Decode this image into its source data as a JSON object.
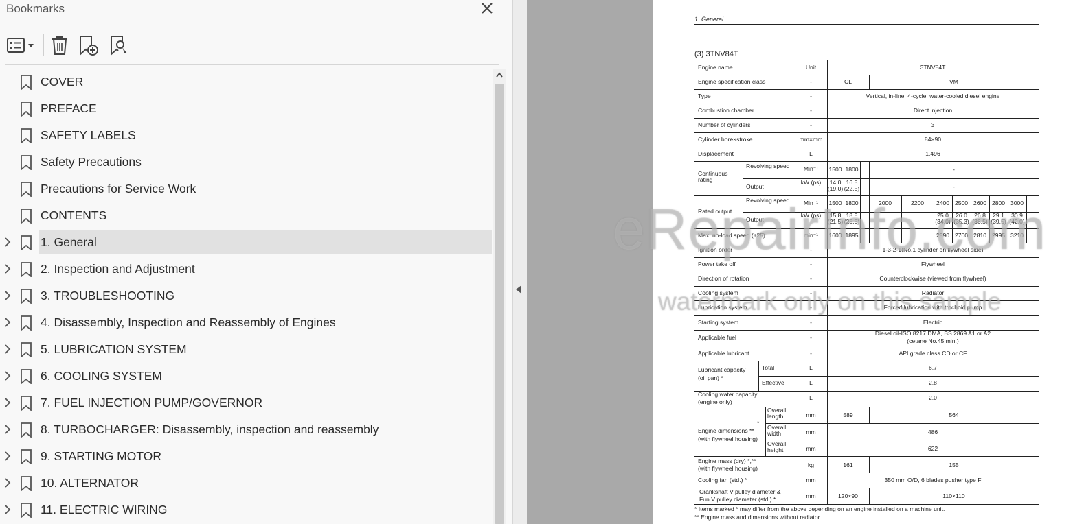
{
  "bookmarks_panel": {
    "title": "Bookmarks",
    "toolbar": {
      "options_icon": "list-options-icon",
      "delete_icon": "trash-icon",
      "new_bookmark_icon": "bookmark-add-icon",
      "find_bookmark_icon": "bookmark-find-icon"
    },
    "items": [
      {
        "label": "COVER",
        "expandable": false,
        "selected": false
      },
      {
        "label": "PREFACE",
        "expandable": false,
        "selected": false
      },
      {
        "label": "SAFETY LABELS",
        "expandable": false,
        "selected": false
      },
      {
        "label": "Safety Precautions",
        "expandable": false,
        "selected": false
      },
      {
        "label": "Precautions for Service Work",
        "expandable": false,
        "selected": false
      },
      {
        "label": "CONTENTS",
        "expandable": false,
        "selected": false
      },
      {
        "label": "1. General",
        "expandable": true,
        "selected": true
      },
      {
        "label": "2. Inspection and Adjustment",
        "expandable": true,
        "selected": false
      },
      {
        "label": "3. TROUBLESHOOTING",
        "expandable": true,
        "selected": false
      },
      {
        "label": "4. Disassembly, Inspection and Reassembly of Engines",
        "expandable": true,
        "selected": false
      },
      {
        "label": "5. LUBRICATION SYSTEM",
        "expandable": true,
        "selected": false
      },
      {
        "label": "6. COOLING SYSTEM",
        "expandable": true,
        "selected": false
      },
      {
        "label": "7. FUEL INJECTION PUMP/GOVERNOR",
        "expandable": true,
        "selected": false
      },
      {
        "label": "8. TURBOCHARGER: Disassembly, inspection and reassembly",
        "expandable": true,
        "selected": false
      },
      {
        "label": "9. STARTING MOTOR",
        "expandable": true,
        "selected": false
      },
      {
        "label": "10. ALTERNATOR",
        "expandable": true,
        "selected": false
      },
      {
        "label": "11. ELECTRIC WIRING",
        "expandable": true,
        "selected": false
      }
    ]
  },
  "document": {
    "header": "1. General",
    "section_title": "(3) 3TNV84T",
    "table": {
      "engine_name": {
        "label": "Engine name",
        "unit": "Unit",
        "value": "3TNV84T"
      },
      "spec_class": {
        "label": "Engine specification class",
        "unit": "-",
        "cl": "CL",
        "vm": "VM"
      },
      "type": {
        "label": "Type",
        "unit": "-",
        "value": "Vertical, in-line, 4-cycle, water-cooled diesel engine"
      },
      "combustion": {
        "label": "Combustion chamber",
        "unit": "-",
        "value": "Direct injection"
      },
      "cylinders": {
        "label": "Number of cylinders",
        "unit": "-",
        "value": "3"
      },
      "bore": {
        "label": "Cylinder bore×stroke",
        "unit": "mm×mm",
        "value": "84×90"
      },
      "displacement": {
        "label": "Displacement",
        "unit": "L",
        "value": "1.496"
      },
      "continuous": {
        "label": "Continuous rating",
        "speed_label": "Revolving speed",
        "speed_unit": "Min⁻¹",
        "speed_1500": "1500",
        "speed_1800": "1800",
        "speed_rest": "-",
        "output_label": "Output",
        "output_unit": "kW (ps)",
        "out_1500": "14.0 (19.0)",
        "out_1800": "16.5 (22.5)",
        "out_rest": "-"
      },
      "rated": {
        "label": "Rated output",
        "speed_label": "Revolving speed",
        "speed_unit": "Min⁻¹",
        "speeds": [
          "1500",
          "1800",
          "2000",
          "2200",
          "2400",
          "2500",
          "2600",
          "2800",
          "3000"
        ],
        "output_label": "Output",
        "output_unit": "kW (ps)",
        "outputs": [
          "15.8 (21.5)",
          "18.8 (25.5)",
          "",
          "",
          "25.0 (34.0)",
          "26.0 (35.3)",
          "26.8 (36.5)",
          "29.1 (39.5)",
          "30.9 (42.0)"
        ]
      },
      "max_noload": {
        "label": "Max. no-load speed (±25)",
        "unit": "min⁻¹",
        "values": [
          "1600",
          "1895",
          "",
          "",
          "2590",
          "2700",
          "2810",
          "2995",
          "3210"
        ]
      },
      "ignition": {
        "label": "Ignition order",
        "unit": "-",
        "value": "1-3-2-1(No.1 cylinder on flywheel side)"
      },
      "pto": {
        "label": "Power take off",
        "unit": "-",
        "value": "Flywheel"
      },
      "rotation": {
        "label": "Direction of rotation",
        "unit": "-",
        "value": "Counterclockwise (viewed from flywheel)"
      },
      "cooling": {
        "label": "Cooling system",
        "unit": "-",
        "value": "Radiator"
      },
      "lubrication": {
        "label": "Lubrication system",
        "unit": "-",
        "value": "Forced lubrication with trochoid pump"
      },
      "starting": {
        "label": "Starting system",
        "unit": "-",
        "value": "Electric"
      },
      "fuel": {
        "label": "Applicable fuel",
        "unit": "-",
        "value_1": "Diesel oil-ISO 8217 DMA, BS 2869 A1 or A2",
        "value_2": "(cetane No.45 min.)"
      },
      "lubricant": {
        "label": "Applicable lubricant",
        "unit": "-",
        "value": "API grade class CD or CF"
      },
      "lub_capacity": {
        "label_1": "Lubricant capacity",
        "label_2": "(oil pan) *",
        "total_label": "Total",
        "total_unit": "L",
        "total": "6.7",
        "eff_label": "Effective",
        "eff_unit": "L",
        "effective": "2.8"
      },
      "water_capacity": {
        "label_1": "Cooling water capacity",
        "label_2": "(engine only)",
        "unit": "L",
        "value": "2.0"
      },
      "dimensions": {
        "star": "*",
        "label_1": "Engine dimensions **",
        "label_2": "(with flywheel housing)",
        "length_label": "Overall length",
        "length_unit": "mm",
        "length_cl": "589",
        "length_vm": "564",
        "width_label": "Overall width",
        "width_unit": "mm",
        "width": "486",
        "height_label": "Overall height",
        "height_unit": "mm",
        "height": "622"
      },
      "mass": {
        "label_1": "Engine mass (dry) *,**",
        "label_2": "(with flywheel housing)",
        "unit": "kg",
        "cl": "161",
        "vm": "155"
      },
      "fan": {
        "label": "Cooling fan (std.) *",
        "unit": "mm",
        "value": "350 mm O/D, 6 blades pusher type F"
      },
      "pulley": {
        "label_1": "Crankshaft V pulley diameter &",
        "label_2": "Fun V pulley diameter   (std.) *",
        "unit": "mm",
        "cl": "120×90",
        "vm": "110×110"
      }
    },
    "notes": [
      "* Items marked * may differ from the above depending on an engine installed on a machine unit.",
      "** Engine mass and dimensions without radiator"
    ]
  },
  "watermark": {
    "line1": "eRepairInfo.com",
    "line2": "watermark only on this sample"
  },
  "colors": {
    "panel_bg": "#f8f8f8",
    "selected_bg": "#e1e1e1",
    "gray_area": "#a9a9a9",
    "page_bg": "#ffffff"
  }
}
